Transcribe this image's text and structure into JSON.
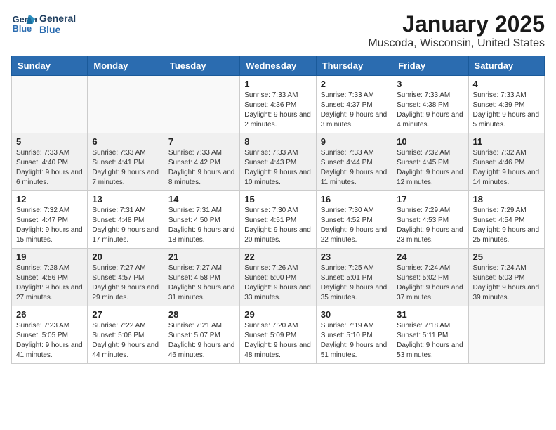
{
  "logo": {
    "line1": "General",
    "line2": "Blue"
  },
  "title": "January 2025",
  "location": "Muscoda, Wisconsin, United States",
  "days_of_week": [
    "Sunday",
    "Monday",
    "Tuesday",
    "Wednesday",
    "Thursday",
    "Friday",
    "Saturday"
  ],
  "weeks": [
    [
      {
        "day": "",
        "info": ""
      },
      {
        "day": "",
        "info": ""
      },
      {
        "day": "",
        "info": ""
      },
      {
        "day": "1",
        "info": "Sunrise: 7:33 AM\nSunset: 4:36 PM\nDaylight: 9 hours and 2 minutes."
      },
      {
        "day": "2",
        "info": "Sunrise: 7:33 AM\nSunset: 4:37 PM\nDaylight: 9 hours and 3 minutes."
      },
      {
        "day": "3",
        "info": "Sunrise: 7:33 AM\nSunset: 4:38 PM\nDaylight: 9 hours and 4 minutes."
      },
      {
        "day": "4",
        "info": "Sunrise: 7:33 AM\nSunset: 4:39 PM\nDaylight: 9 hours and 5 minutes."
      }
    ],
    [
      {
        "day": "5",
        "info": "Sunrise: 7:33 AM\nSunset: 4:40 PM\nDaylight: 9 hours and 6 minutes."
      },
      {
        "day": "6",
        "info": "Sunrise: 7:33 AM\nSunset: 4:41 PM\nDaylight: 9 hours and 7 minutes."
      },
      {
        "day": "7",
        "info": "Sunrise: 7:33 AM\nSunset: 4:42 PM\nDaylight: 9 hours and 8 minutes."
      },
      {
        "day": "8",
        "info": "Sunrise: 7:33 AM\nSunset: 4:43 PM\nDaylight: 9 hours and 10 minutes."
      },
      {
        "day": "9",
        "info": "Sunrise: 7:33 AM\nSunset: 4:44 PM\nDaylight: 9 hours and 11 minutes."
      },
      {
        "day": "10",
        "info": "Sunrise: 7:32 AM\nSunset: 4:45 PM\nDaylight: 9 hours and 12 minutes."
      },
      {
        "day": "11",
        "info": "Sunrise: 7:32 AM\nSunset: 4:46 PM\nDaylight: 9 hours and 14 minutes."
      }
    ],
    [
      {
        "day": "12",
        "info": "Sunrise: 7:32 AM\nSunset: 4:47 PM\nDaylight: 9 hours and 15 minutes."
      },
      {
        "day": "13",
        "info": "Sunrise: 7:31 AM\nSunset: 4:48 PM\nDaylight: 9 hours and 17 minutes."
      },
      {
        "day": "14",
        "info": "Sunrise: 7:31 AM\nSunset: 4:50 PM\nDaylight: 9 hours and 18 minutes."
      },
      {
        "day": "15",
        "info": "Sunrise: 7:30 AM\nSunset: 4:51 PM\nDaylight: 9 hours and 20 minutes."
      },
      {
        "day": "16",
        "info": "Sunrise: 7:30 AM\nSunset: 4:52 PM\nDaylight: 9 hours and 22 minutes."
      },
      {
        "day": "17",
        "info": "Sunrise: 7:29 AM\nSunset: 4:53 PM\nDaylight: 9 hours and 23 minutes."
      },
      {
        "day": "18",
        "info": "Sunrise: 7:29 AM\nSunset: 4:54 PM\nDaylight: 9 hours and 25 minutes."
      }
    ],
    [
      {
        "day": "19",
        "info": "Sunrise: 7:28 AM\nSunset: 4:56 PM\nDaylight: 9 hours and 27 minutes."
      },
      {
        "day": "20",
        "info": "Sunrise: 7:27 AM\nSunset: 4:57 PM\nDaylight: 9 hours and 29 minutes."
      },
      {
        "day": "21",
        "info": "Sunrise: 7:27 AM\nSunset: 4:58 PM\nDaylight: 9 hours and 31 minutes."
      },
      {
        "day": "22",
        "info": "Sunrise: 7:26 AM\nSunset: 5:00 PM\nDaylight: 9 hours and 33 minutes."
      },
      {
        "day": "23",
        "info": "Sunrise: 7:25 AM\nSunset: 5:01 PM\nDaylight: 9 hours and 35 minutes."
      },
      {
        "day": "24",
        "info": "Sunrise: 7:24 AM\nSunset: 5:02 PM\nDaylight: 9 hours and 37 minutes."
      },
      {
        "day": "25",
        "info": "Sunrise: 7:24 AM\nSunset: 5:03 PM\nDaylight: 9 hours and 39 minutes."
      }
    ],
    [
      {
        "day": "26",
        "info": "Sunrise: 7:23 AM\nSunset: 5:05 PM\nDaylight: 9 hours and 41 minutes."
      },
      {
        "day": "27",
        "info": "Sunrise: 7:22 AM\nSunset: 5:06 PM\nDaylight: 9 hours and 44 minutes."
      },
      {
        "day": "28",
        "info": "Sunrise: 7:21 AM\nSunset: 5:07 PM\nDaylight: 9 hours and 46 minutes."
      },
      {
        "day": "29",
        "info": "Sunrise: 7:20 AM\nSunset: 5:09 PM\nDaylight: 9 hours and 48 minutes."
      },
      {
        "day": "30",
        "info": "Sunrise: 7:19 AM\nSunset: 5:10 PM\nDaylight: 9 hours and 51 minutes."
      },
      {
        "day": "31",
        "info": "Sunrise: 7:18 AM\nSunset: 5:11 PM\nDaylight: 9 hours and 53 minutes."
      },
      {
        "day": "",
        "info": ""
      }
    ]
  ]
}
